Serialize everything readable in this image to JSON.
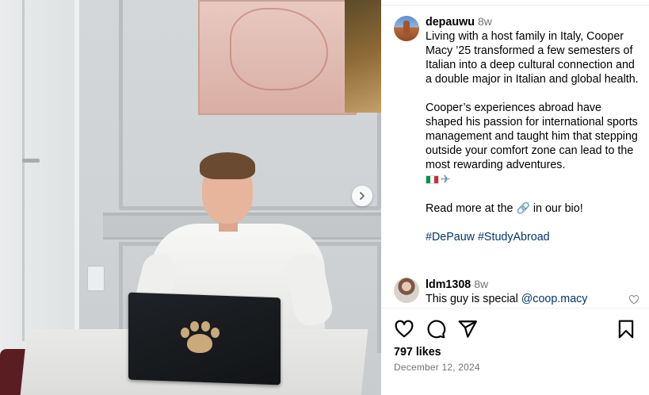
{
  "post": {
    "username": "depauwu",
    "age": "8w",
    "caption": {
      "p1": "Living with a host family in Italy, Cooper Macy ’25 transformed a few semesters of Italian into a deep cultural connection and a double major in Italian and global health.",
      "p2": "Cooper’s experiences abroad have shaped his passion for international sports management and taught him that stepping outside your comfort zone can lead to the most rewarding adventures.",
      "emoji_plane": "✈",
      "p3_before": "Read more at the",
      "link_emoji": "🔗",
      "p3_after": "in our bio!",
      "hashtags": [
        "#DePauw",
        "#StudyAbroad"
      ]
    },
    "comment": {
      "username": "ldm1308",
      "age": "8w",
      "text": "This guy is special",
      "mention": "@coop.macy"
    },
    "likes": "797 likes",
    "date": "December 12, 2024"
  },
  "icons": {
    "next": "chevron-right-icon",
    "like": "heart-icon",
    "comment": "comment-icon",
    "share": "share-icon",
    "save": "bookmark-icon"
  },
  "colors": {
    "hashtag": "#00376b",
    "muted": "#737373"
  }
}
